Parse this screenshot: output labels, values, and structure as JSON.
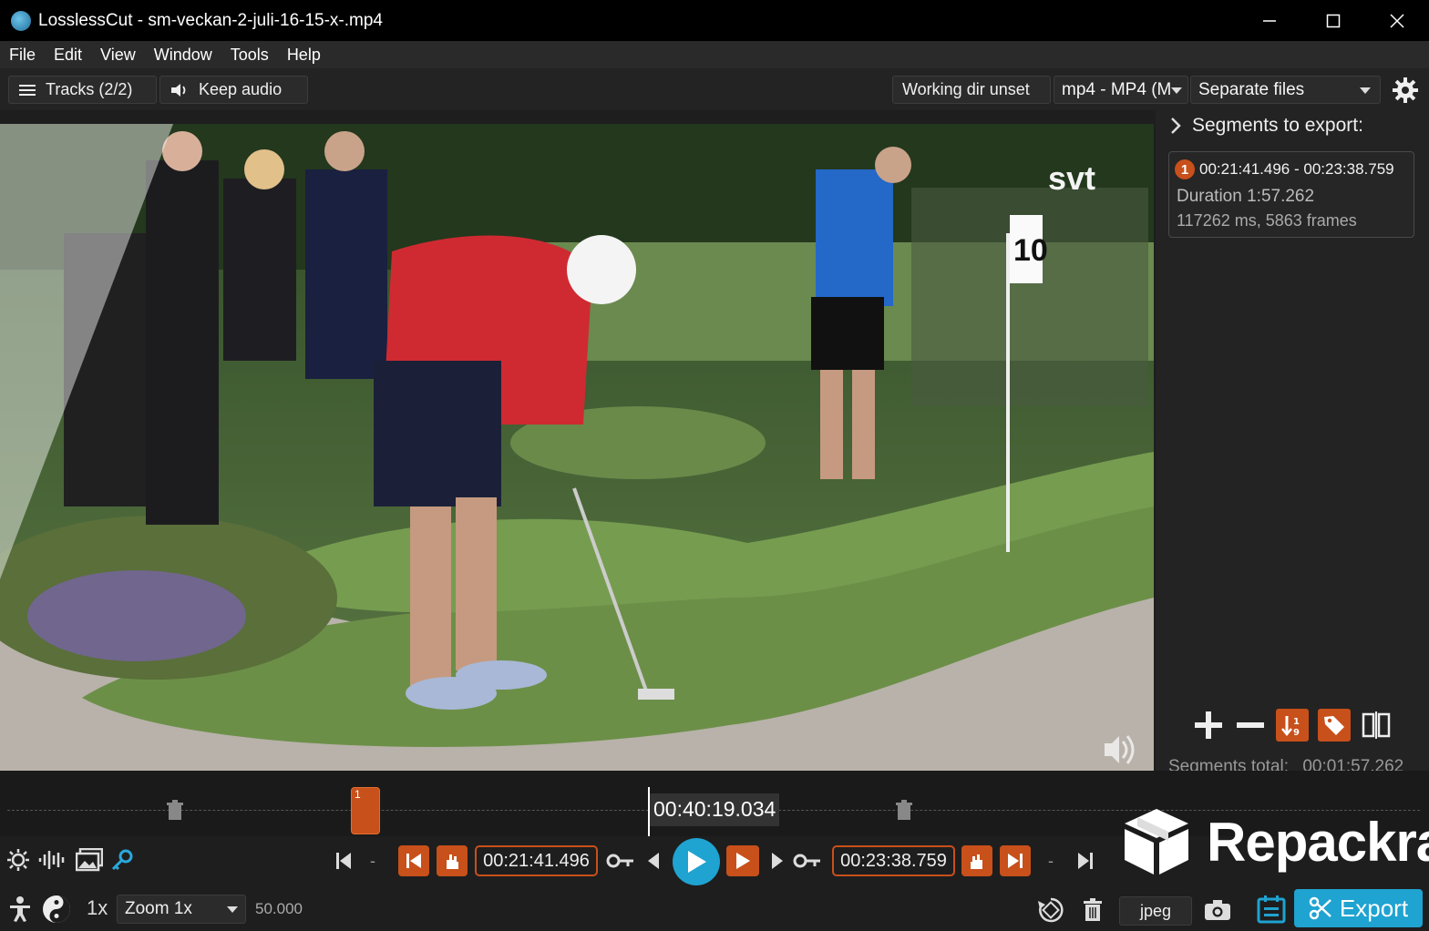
{
  "window": {
    "title": "LosslessCut - sm-veckan-2-juli-16-15-x-.mp4"
  },
  "menu": [
    "File",
    "Edit",
    "View",
    "Window",
    "Tools",
    "Help"
  ],
  "toolbar": {
    "tracks_label": "Tracks (2/2)",
    "audio_label": "Keep audio",
    "working_dir": "Working dir unset",
    "format": "mp4 - MP4 (M",
    "output_mode": "Separate files"
  },
  "video_overlay": {
    "svt": "svt",
    "flag_number": "10"
  },
  "segments": {
    "header": "Segments to export:",
    "items": [
      {
        "num": "1",
        "range": "00:21:41.496 - 00:23:38.759",
        "duration": "Duration 1:57.262",
        "frames": "117262 ms, 5863 frames"
      }
    ],
    "total_label": "Segments total:",
    "total_value": "00:01:57.262"
  },
  "timeline": {
    "current_time": "00:40:19.034",
    "segment_marker": "1"
  },
  "controls": {
    "cut_start": "00:21:41.496",
    "cut_end": "00:23:38.759",
    "speed": "1x",
    "zoom": "Zoom 1x",
    "fps": "50.000",
    "capture_format": "jpeg",
    "export_label": "Export"
  },
  "watermark": "Repackra",
  "colors": {
    "accent_orange": "#c8501a",
    "accent_blue": "#1fa3d1"
  }
}
